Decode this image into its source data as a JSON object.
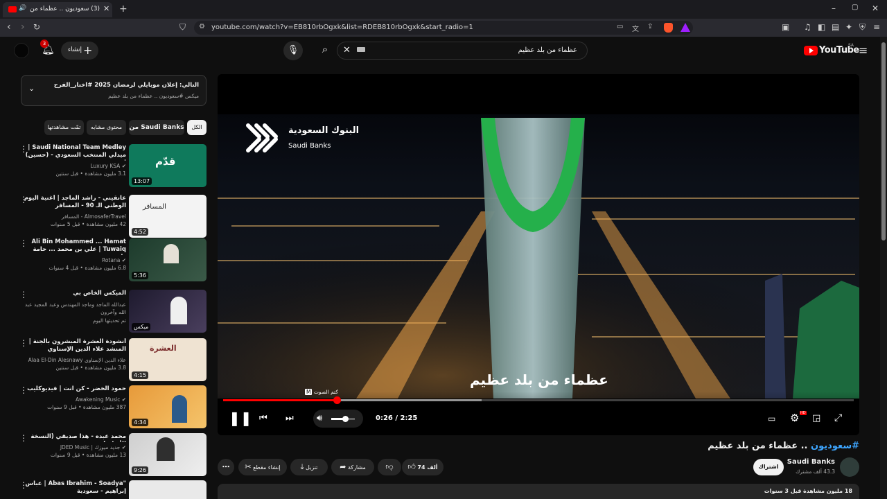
{
  "browser": {
    "tab_title": "(3) سعوديون .. عظماء من بلد",
    "url": "youtube.com/watch?v=EB810rbOgxk&list=RDEB810rbOgxk&start_radio=1"
  },
  "header": {
    "logo_text": "YouTube",
    "logo_region": "SA",
    "search_value": "عظماء من بلد عظيم",
    "create_label": "إنشاء",
    "notifications_count": "3"
  },
  "up_next": {
    "title": "التالي: إعلان موبايلي لرمضان 2025 #اختار_الفرح",
    "subtitle": "ميكس #سعوديون .. عظماء من بلد عظيم"
  },
  "filters": [
    "الكل",
    "من Saudi Banks",
    "محتوى مشابه",
    "تمّت مشاهدتها"
  ],
  "recommendations": [
    {
      "title": "Saudi National Team Medley | ميدلي المنتخب السعودي - (حسين) | ...",
      "channel": "Luxury KSA",
      "verified": true,
      "meta": "3.1 مليون مشاهدة • قبل سنتين",
      "duration": "13:07",
      "thumb_bg": "#0f7a5c"
    },
    {
      "title": "عانقيني - راشد الماجد | أغنية اليوم الوطني الـ 90 - المسافر",
      "channel": "AlmosaferTravel - المسافر",
      "verified": false,
      "meta": "42 مليون مشاهدة • قبل 5 سنوات",
      "duration": "4:52",
      "thumb_bg": "#f3f3f3"
    },
    {
      "title": "Ali Bin Mohammed ... Hamat Tuwaiq | علي بن محمد ... حامة طويق",
      "channel": "Rotana",
      "verified": true,
      "meta": "6.8 مليون مشاهدة • قبل 4 سنوات",
      "duration": "5:36",
      "thumb_bg": "#1d3b2c"
    },
    {
      "title": "الميكس الخاص بي",
      "channel": "عبدالله الماجد وماجد المهندس وعبد المجيد عبد الله وآخرون",
      "verified": false,
      "meta": "تم تحديثها اليوم",
      "duration": "ميكس",
      "thumb_bg": "#2d2440"
    },
    {
      "title": "أنشودة العشرة المبشرون بالجنة | المنشد علاء الدين الإسناوي",
      "channel": "علاء الدين الإسناوي Alaa El-Din Alesnawy",
      "verified": false,
      "meta": "3.8 مليون مشاهدة • قبل سنتين",
      "duration": "4:15",
      "thumb_bg": "#efe3d2"
    },
    {
      "title": "حمود الخضر - كن انت | فيديوكليب",
      "channel": "Awakening Music",
      "verified": true,
      "meta": "387 مليون مشاهدة • قبل 9 سنوات",
      "duration": "4:34",
      "thumb_bg": "#e79a3a"
    },
    {
      "title": "محمد عبده - هذا صديقي (النسخة الأصلية)",
      "channel": "جديد ميوزك | JDED Music",
      "verified": true,
      "meta": "13 مليون مشاهدة • قبل 9 سنوات",
      "duration": "9:26",
      "thumb_bg": "#d6d6d6"
    },
    {
      "title": "\"Abas Ibrahim - Soadya | عباس إبراهيم - سعودية",
      "channel": "",
      "verified": false,
      "meta": "",
      "duration": "",
      "thumb_bg": "#e9e9e9"
    }
  ],
  "player": {
    "overlay_brand_ar": "البنوك السعودية",
    "overlay_brand_en": "Saudi Banks",
    "caption": "عظماء من بلد عظيم",
    "time_current": "0:26",
    "time_total": "2:25",
    "progress": 0.18,
    "buffered": 0.41,
    "volume": 0.6,
    "mute_tooltip": "كتم الصوت",
    "mute_key": "M",
    "hd_badge": "HD"
  },
  "video": {
    "hashtag": "#سعوديون",
    "title_rest": " .. عظماء من بلد عظيم",
    "channel_name": "Saudi Banks",
    "subscribers": "43.3 ألف مشترك",
    "subscribe_label": "اشتراك",
    "likes": "74 ألف",
    "share_label": "مشاركة",
    "download_label": "تنزيل",
    "clip_label": "إنشاء مقطع",
    "views": "18 مليون مشاهدة",
    "published": "قبل 3 سنوات"
  },
  "colors": {
    "accent_red": "#ff0000",
    "background": "#0f0f0f",
    "chip_bg": "#272727"
  }
}
